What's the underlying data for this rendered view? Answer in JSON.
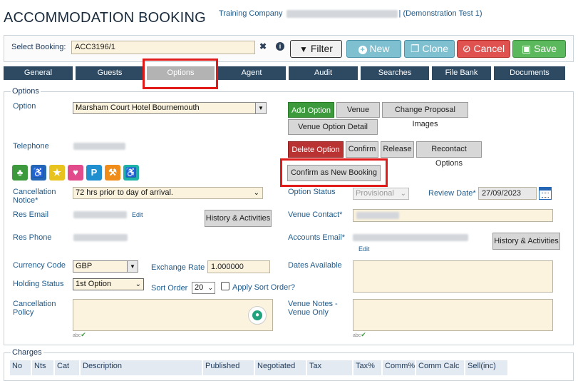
{
  "header": {
    "title": "ACCOMMODATION BOOKING",
    "company_prefix": "Training Company",
    "company_suffix": "| (Demonstration Test 1)"
  },
  "toolbar": {
    "select_label": "Select Booking:",
    "booking_value": "ACC3196/1",
    "filter": "Filter",
    "new": "New",
    "clone": "Clone",
    "cancel": "Cancel",
    "save": "Save"
  },
  "tabs": [
    "General",
    "Guests",
    "Options",
    "Agent",
    "Audit",
    "Searches",
    "File Bank",
    "Documents"
  ],
  "active_tab": "Options",
  "options": {
    "legend": "Options",
    "option_label": "Option",
    "option_value": "Marsham Court Hotel Bournemouth",
    "telephone_label": "Telephone",
    "cancel_notice_label": "Cancellation Notice*",
    "cancel_notice_value": "72 hrs prior to day of arrival.",
    "res_email_label": "Res Email",
    "res_phone_label": "Res Phone",
    "edit": "Edit",
    "history_btn": "History & Activities",
    "currency_label": "Currency Code",
    "currency_value": "GBP",
    "exchange_label": "Exchange Rate",
    "exchange_value": "1.000000",
    "holding_label": "Holding Status",
    "holding_value": "1st Option",
    "sort_label": "Sort Order",
    "sort_value": "20",
    "apply_sort": "Apply Sort Order?",
    "cancel_policy_label": "Cancellation Policy",
    "option_status_label": "Option Status",
    "option_status_value": "Provisional",
    "review_label": "Review Date*",
    "review_value": "27/09/2023",
    "venue_contact_label": "Venue Contact*",
    "accounts_email_label": "Accounts Email*",
    "dates_available_label": "Dates Available",
    "venue_notes_label": "Venue Notes - Venue Only",
    "spell": "abc"
  },
  "actions": {
    "add_option": "Add Option",
    "venue": "Venue",
    "change_images": "Change Proposal Images",
    "venue_detail": "Venue Option Detail",
    "delete_option": "Delete Option",
    "confirm": "Confirm",
    "release": "Release",
    "recontact": "Recontact Options",
    "confirm_new": "Confirm as New Booking"
  },
  "amenity_icons": [
    "garden-icon",
    "accessible-icon",
    "award-icon",
    "wedding-icon",
    "parking-icon",
    "activity-icon",
    "accessible-room-icon"
  ],
  "charges": {
    "legend": "Charges",
    "columns": [
      "No",
      "Nts",
      "Cat",
      "Description",
      "Published",
      "Negotiated",
      "Tax",
      "Tax%",
      "Comm%",
      "Comm Calc",
      "Sell(inc)"
    ]
  },
  "colors": {
    "nav": "#2e4a63",
    "add_option": "#3c9a3c",
    "delete_option": "#b93333",
    "highlight": "#e11a1a",
    "input_bg": "#fbf3dd"
  }
}
